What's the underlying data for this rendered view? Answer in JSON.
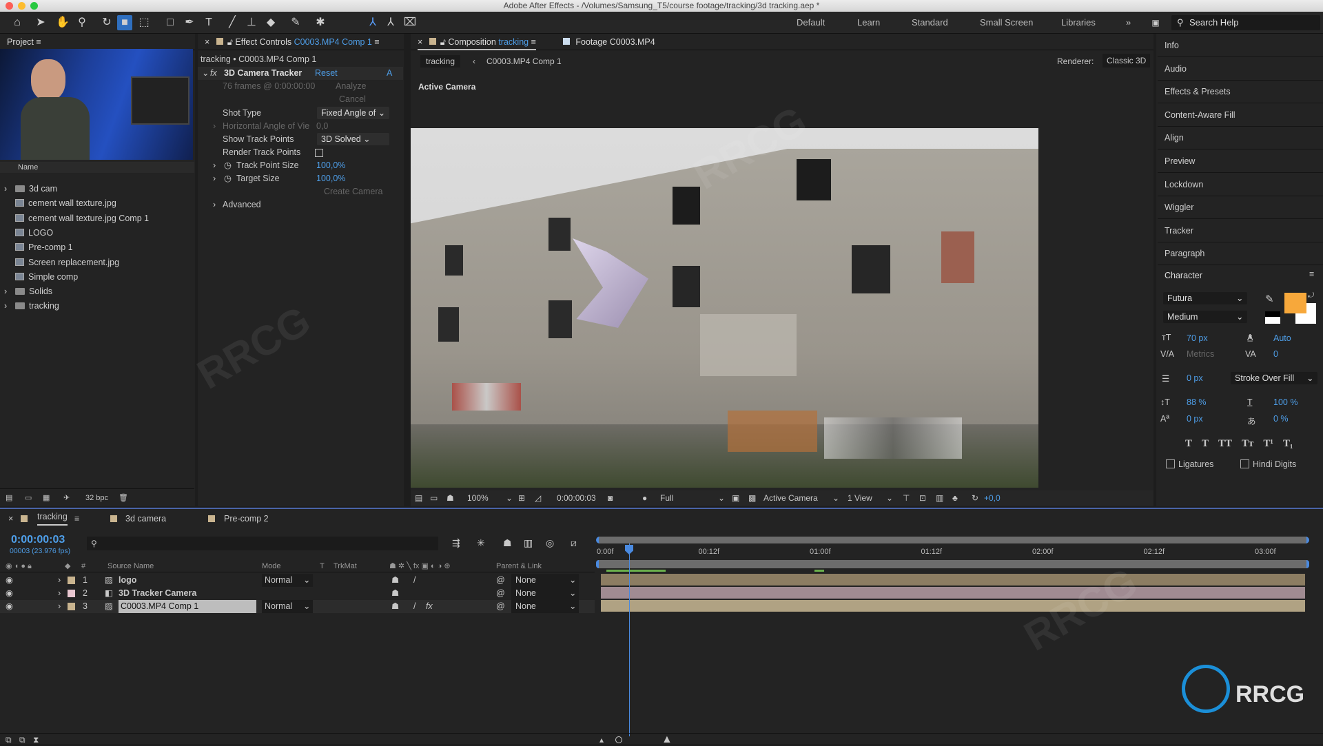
{
  "window": {
    "title": "Adobe After Effects - /Volumes/Samsung_T5/course footage/tracking/3d tracking.aep *"
  },
  "workspaces": [
    "Default",
    "Learn",
    "Standard",
    "Small Screen",
    "Libraries"
  ],
  "search_help": "Search Help",
  "project": {
    "title": "Project",
    "name_col": "Name",
    "items": [
      {
        "label": "3d cam",
        "type": "folder"
      },
      {
        "label": "cement wall texture.jpg",
        "type": "file"
      },
      {
        "label": "cement wall texture.jpg Comp 1",
        "type": "file"
      },
      {
        "label": "LOGO",
        "type": "file"
      },
      {
        "label": "Pre-comp 1",
        "type": "file"
      },
      {
        "label": "Screen replacement.jpg",
        "type": "file"
      },
      {
        "label": "Simple comp",
        "type": "file"
      },
      {
        "label": "Solids",
        "type": "folder"
      },
      {
        "label": "tracking",
        "type": "folder"
      }
    ],
    "bpc": "32 bpc"
  },
  "effect_controls": {
    "tab_prefix": "Effect Controls",
    "tab_comp": "C0003.MP4 Comp 1",
    "breadcrumb": "tracking • C0003.MP4 Comp 1",
    "effect": "3D Camera Tracker",
    "reset": "Reset",
    "about": "A",
    "frames": "76 frames @ 0:00:00:00",
    "analyze": "Analyze",
    "cancel": "Cancel",
    "shot_type_label": "Shot Type",
    "shot_type_value": "Fixed Angle of",
    "hfov_label": "Horizontal Angle of Vie",
    "hfov_value": "0,0",
    "show_tp_label": "Show Track Points",
    "show_tp_value": "3D Solved",
    "render_tp_label": "Render Track Points",
    "render_tp_checked": false,
    "tp_size_label": "Track Point Size",
    "tp_size_value": "100,0%",
    "target_label": "Target Size",
    "target_value": "100,0%",
    "create_camera": "Create Camera",
    "advanced": "Advanced"
  },
  "composition": {
    "tab_prefix": "Composition",
    "tab_comp": "tracking",
    "footage_tab": "Footage C0003.MP4",
    "crumb1": "tracking",
    "crumb2": "C0003.MP4 Comp 1",
    "renderer_label": "Renderer:",
    "renderer_value": "Classic 3D",
    "view_label": "Active Camera",
    "bottom": {
      "zoom": "100%",
      "timecode": "0:00:00:03",
      "resolution": "Full",
      "camera": "Active Camera",
      "views": "1 View",
      "exposure": "+0,0"
    }
  },
  "right_panel": {
    "items": [
      "Info",
      "Audio",
      "Effects & Presets",
      "Content-Aware Fill",
      "Align",
      "Preview",
      "Lockdown",
      "Wiggler",
      "Tracker",
      "Paragraph"
    ],
    "character": {
      "title": "Character",
      "font": "Futura",
      "style": "Medium",
      "fill_color": "#f7a83b",
      "size": "70 px",
      "leading": "Auto",
      "kerning": "Metrics",
      "tracking": "0",
      "stroke_width": "0 px",
      "stroke_mode": "Stroke Over Fill",
      "vscale": "88 %",
      "hscale": "100 %",
      "baseline": "0 px",
      "tsume": "0 %",
      "ligatures": "Ligatures",
      "hindi_digits": "Hindi Digits",
      "styles": [
        "T",
        "T",
        "TT",
        "Tт",
        "T¹",
        "T₁"
      ]
    }
  },
  "timeline": {
    "tabs": [
      "tracking",
      "3d camera",
      "Pre-comp 2"
    ],
    "timecode": "0:00:00:03",
    "frame_info": "00003 (23.976 fps)",
    "columns": {
      "num": "#",
      "source": "Source Name",
      "mode": "Mode",
      "t": "T",
      "trkmat": "TrkMat",
      "parent": "Parent & Link"
    },
    "layers": [
      {
        "num": "1",
        "name": "logo",
        "mode": "Normal",
        "parent": "None",
        "color": "#c9b48f"
      },
      {
        "num": "2",
        "name": "3D Tracker Camera",
        "mode": "",
        "parent": "None",
        "color": "#e8c6d0"
      },
      {
        "num": "3",
        "name": "C0003.MP4 Comp 1",
        "mode": "Normal",
        "parent": "None",
        "color": "#c9b48f"
      }
    ],
    "ruler": [
      "0:00f",
      "00:12f",
      "01:00f",
      "01:12f",
      "02:00f",
      "02:12f",
      "03:00f"
    ]
  },
  "watermark": "RRCG"
}
